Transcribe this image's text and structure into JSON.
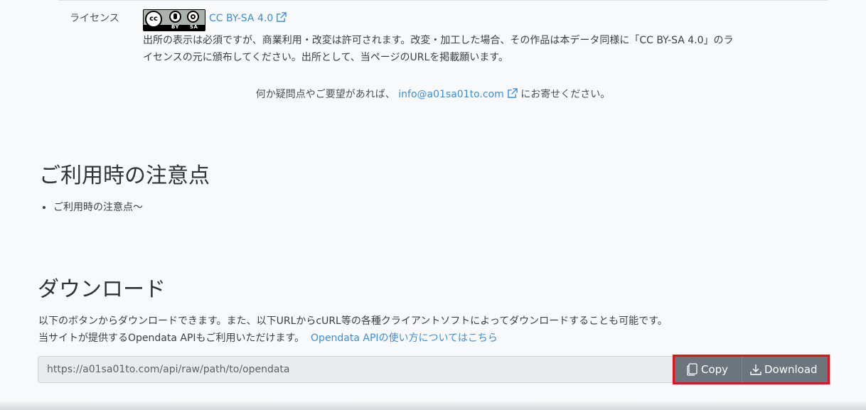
{
  "license": {
    "label": "ライセンス",
    "badge": {
      "main": "cc",
      "by": "BY",
      "sa": "SA"
    },
    "link_text": "CC BY-SA 4.0",
    "description_line1": "出所の表示は必須ですが、商業利用・改変は許可されます。改変・加工した場合、その作品は本データ同様に「CC BY-SA 4.0」のラ",
    "description_line2": "イセンスの元に頒布してください。出所として、当ページのURLを掲載願います。"
  },
  "contact": {
    "prefix": "何か疑問点やご要望があれば、",
    "email": "info@a01sa01to.com",
    "suffix": "にお寄せください。"
  },
  "notice": {
    "title": "ご利用時の注意点",
    "items": [
      "ご利用時の注意点〜"
    ]
  },
  "download": {
    "title": "ダウンロード",
    "desc_line1": "以下のボタンからダウンロードできます。また、以下URLからcURL等の各種クライアントソフトによってダウンロードすることも可能です。",
    "desc_line2": "当サイトが提供するOpendata APIもご利用いただけます。",
    "api_link": "Opendata APIの使い方についてはこちら",
    "url": "https://a01sa01to.com/api/raw/path/to/opendata",
    "copy_label": "Copy",
    "download_label": "Download"
  },
  "colors": {
    "link": "#3b8fd9",
    "button": "#6c757d",
    "highlight": "#e1141e"
  }
}
